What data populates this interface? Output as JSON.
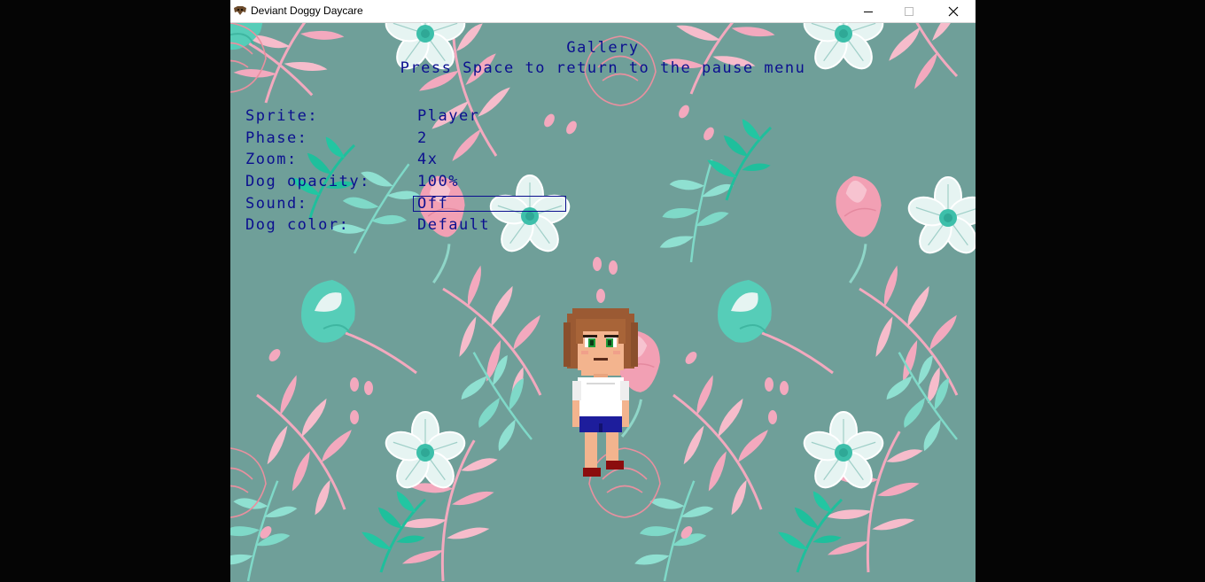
{
  "window": {
    "title": "Deviant Doggy Daycare",
    "controls": [
      "minimize-icon",
      "maximize-icon",
      "close-icon"
    ]
  },
  "gallery": {
    "title": "Gallery",
    "hint": "Press Space to return to the pause menu",
    "options": [
      {
        "label": "Sprite:",
        "value": "Player"
      },
      {
        "label": "Phase:",
        "value": "2"
      },
      {
        "label": "Zoom:",
        "value": "4x"
      },
      {
        "label": "Dog opacity:",
        "value": "100%"
      },
      {
        "label": "Sound:",
        "value": "Off"
      },
      {
        "label": "Dog color:",
        "value": "Default"
      }
    ],
    "selected_option": "Sound:"
  },
  "colors": {
    "text": "#0b0f8f",
    "background": "#6f9f99",
    "pink": "#f3a9be",
    "teal": "#3ccbb0",
    "white_flower": "#e6f4f2"
  },
  "preview": {
    "sprite": "player-girl-sprite"
  }
}
